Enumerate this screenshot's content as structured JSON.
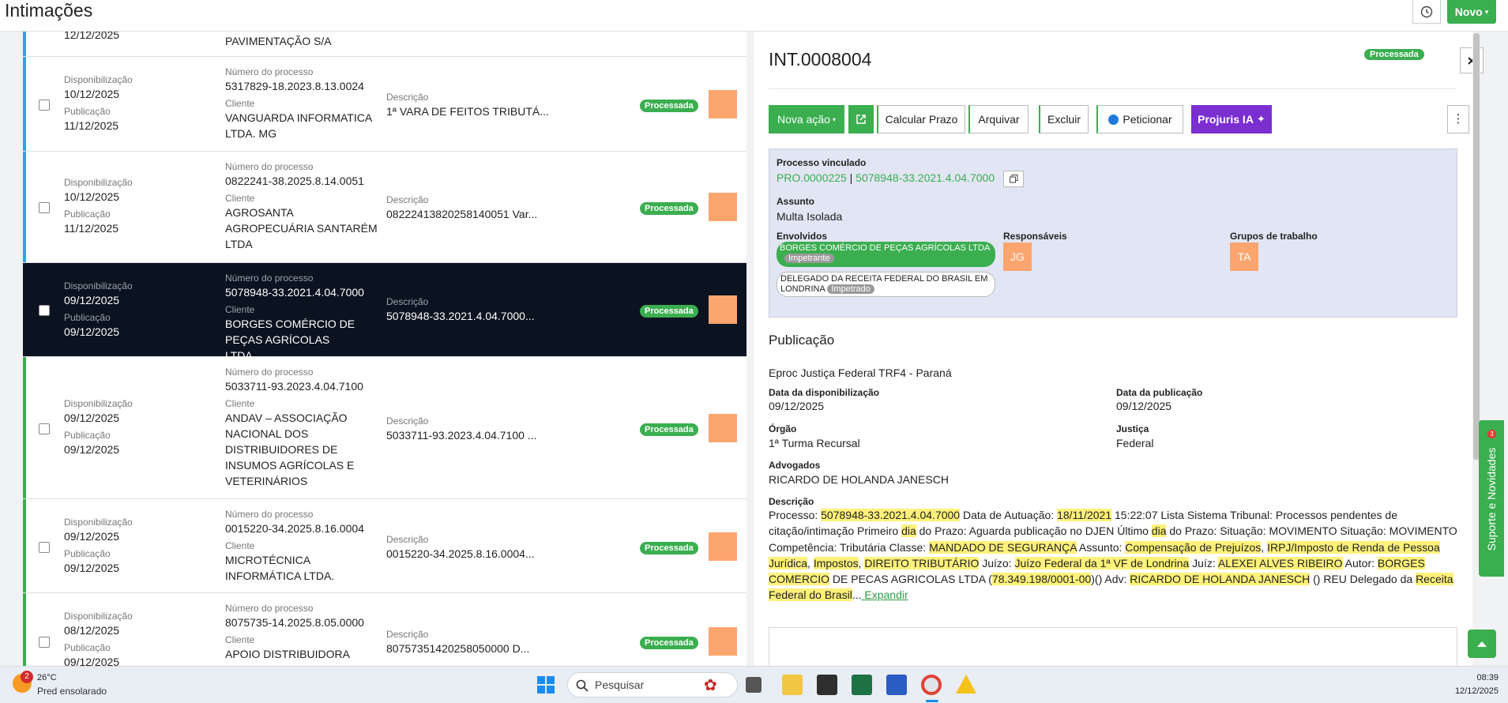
{
  "header": {
    "title": "Intimações",
    "novo_label": "Novo"
  },
  "list": {
    "partial_top": {
      "date": "12/12/2025",
      "client": "PAVIMENTAÇÃO S/A"
    },
    "rows": [
      {
        "disp_label": "Disponibilização",
        "disp": "10/12/2025",
        "pub_label": "Publicação",
        "pub": "11/12/2025",
        "proc_label": "Número do processo",
        "proc": "5317829-18.2023.8.13.0024",
        "client_label": "Cliente",
        "client": "VANGUARDA INFORMATICA LTDA. MG",
        "desc_label": "Descrição",
        "desc": "1ª VARA DE FEITOS TRIBUTÁ...",
        "status": "Processada"
      },
      {
        "disp_label": "Disponibilização",
        "disp": "10/12/2025",
        "pub_label": "Publicação",
        "pub": "11/12/2025",
        "proc_label": "Número do processo",
        "proc": "0822241-38.2025.8.14.0051",
        "client_label": "Cliente",
        "client": "AGROSANTA AGROPECUÁRIA SANTARÉM LTDA",
        "desc_label": "Descrição",
        "desc": "08222413820258140051 Var...",
        "status": "Processada"
      },
      {
        "disp_label": "Disponibilização",
        "disp": "09/12/2025",
        "pub_label": "Publicação",
        "pub": "09/12/2025",
        "proc_label": "Número do processo",
        "proc": "5078948-33.2021.4.04.7000",
        "client_label": "Cliente",
        "client": "BORGES COMÉRCIO DE PEÇAS AGRÍCOLAS LTDA",
        "desc_label": "Descrição",
        "desc": "5078948-33.2021.4.04.7000...",
        "status": "Processada"
      },
      {
        "disp_label": "Disponibilização",
        "disp": "09/12/2025",
        "pub_label": "Publicação",
        "pub": "09/12/2025",
        "proc_label": "Número do processo",
        "proc": "5033711-93.2023.4.04.7100",
        "client_label": "Cliente",
        "client": "ANDAV – ASSOCIAÇÃO NACIONAL DOS DISTRIBUIDORES DE INSUMOS AGRÍCOLAS E VETERINÁRIOS",
        "desc_label": "Descrição",
        "desc": "5033711-93.2023.4.04.7100 ...",
        "status": "Processada"
      },
      {
        "disp_label": "Disponibilização",
        "disp": "09/12/2025",
        "pub_label": "Publicação",
        "pub": "09/12/2025",
        "proc_label": "Número do processo",
        "proc": "0015220-34.2025.8.16.0004",
        "client_label": "Cliente",
        "client": "MICROTÉCNICA INFORMÁTICA LTDA.",
        "desc_label": "Descrição",
        "desc": "0015220-34.2025.8.16.0004...",
        "status": "Processada"
      },
      {
        "disp_label": "Disponibilização",
        "disp": "08/12/2025",
        "pub_label": "Publicação",
        "pub": "09/12/2025",
        "proc_label": "Número do processo",
        "proc": "8075735-14.2025.8.05.0000",
        "client_label": "Cliente",
        "client": "APOIO DISTRIBUIDORA",
        "desc_label": "Descrição",
        "desc": "80757351420258050000 D...",
        "status": "Processada"
      }
    ]
  },
  "detail": {
    "id": "INT.0008004",
    "status": "Processada",
    "actions": {
      "nova_acao": "Nova ação",
      "calcular_prazo": "Calcular Prazo",
      "arquivar": "Arquivar",
      "excluir": "Excluir",
      "peticionar": "Peticionar",
      "projuris_ia": "Projuris IA"
    },
    "vinculado_label": "Processo vinculado",
    "vinculado_pro": "PRO.0000225",
    "vinculado_sep": "|",
    "vinculado_num": "5078948-33.2021.4.04.7000",
    "assunto_label": "Assunto",
    "assunto": "Multa Isolada",
    "envolvidos_label": "Envolvidos",
    "envolvido1": "BORGES COMÉRCIO DE PEÇAS AGRÍCOLAS LTDA",
    "envolvido1_tag": "Impetrante",
    "envolvido2": "DELEGADO DA RECEITA FEDERAL DO BRASIL EM LONDRINA",
    "envolvido2_tag": "Impetrado",
    "responsaveis_label": "Responsáveis",
    "responsavel": "JG",
    "grupos_label": "Grupos de trabalho",
    "grupo": "TA",
    "publicacao_title": "Publicação",
    "fonte": "Eproc Justiça Federal TRF4 - Paraná",
    "data_disp_label": "Data da disponibilização",
    "data_disp": "09/12/2025",
    "data_pub_label": "Data da publicação",
    "data_pub": "09/12/2025",
    "orgao_label": "Órgão",
    "orgao": "1ª Turma Recursal",
    "justica_label": "Justiça",
    "justica": "Federal",
    "advogados_label": "Advogados",
    "advogados": "RICARDO DE HOLANDA JANESCH",
    "descricao_label": "Descrição",
    "descricao_parts": [
      {
        "t": "Processo: ",
        "h": false
      },
      {
        "t": "5078948-33.2021.4.04.7000",
        "h": true
      },
      {
        "t": " Data de Autuação: ",
        "h": false
      },
      {
        "t": "18/11/2021",
        "h": true
      },
      {
        "t": " 15:22:07 Lista Sistema Tribunal: Processos pendentes de citação/intimação Primeiro ",
        "h": false
      },
      {
        "t": "dia",
        "h": true
      },
      {
        "t": " do Prazo: Aguarda publicação no DJEN Último ",
        "h": false
      },
      {
        "t": "dia",
        "h": true
      },
      {
        "t": " do Prazo: Situação: MOVIMENTO Situação: MOVIMENTO Competência: Tributária Classe: ",
        "h": false
      },
      {
        "t": "MANDADO DE SEGURANÇA",
        "h": true
      },
      {
        "t": " Assunto: ",
        "h": false
      },
      {
        "t": "Compensação de Prejuízos",
        "h": true
      },
      {
        "t": ", ",
        "h": false
      },
      {
        "t": "IRPJ/Imposto de Renda de Pessoa Jurídica",
        "h": true
      },
      {
        "t": ", ",
        "h": false
      },
      {
        "t": "Impostos",
        "h": true
      },
      {
        "t": ", ",
        "h": false
      },
      {
        "t": "DIREITO TRIBUTÁRIO",
        "h": true
      },
      {
        "t": " Juízo: ",
        "h": false
      },
      {
        "t": "Juízo Federal da 1ª VF de Londrina",
        "h": true
      },
      {
        "t": " Juíz: ",
        "h": false
      },
      {
        "t": "ALEXEI ALVES RIBEIRO",
        "h": true
      },
      {
        "t": " Autor: ",
        "h": false
      },
      {
        "t": "BORGES COMERCIO",
        "h": true
      },
      {
        "t": " DE PECAS AGRICOLAS LTDA (",
        "h": false
      },
      {
        "t": "78.349.198/0001-00",
        "h": true
      },
      {
        "t": ")() Adv: ",
        "h": false
      },
      {
        "t": "RICARDO DE HOLANDA JANESCH",
        "h": true
      },
      {
        "t": " () REU Delegado da ",
        "h": false
      },
      {
        "t": "Receita Federal do Brasil",
        "h": true
      },
      {
        "t": "...",
        "h": false
      }
    ],
    "expandir": "Expandir"
  },
  "side_tab": {
    "label": "Suporte e Novidades",
    "count": "3"
  },
  "taskbar": {
    "weather_temp": "26°C",
    "weather_desc": "Pred ensolarado",
    "weather_badge": "2",
    "search_placeholder": "Pesquisar",
    "time": "08:39",
    "date": "12/12/2025"
  },
  "colors": {
    "green": "#3bae50",
    "blue": "#28a9e0",
    "orange": "#fca56f",
    "purple": "#7b2fd1",
    "highlight": "#fef17a",
    "selected_row": "#0b1220"
  }
}
